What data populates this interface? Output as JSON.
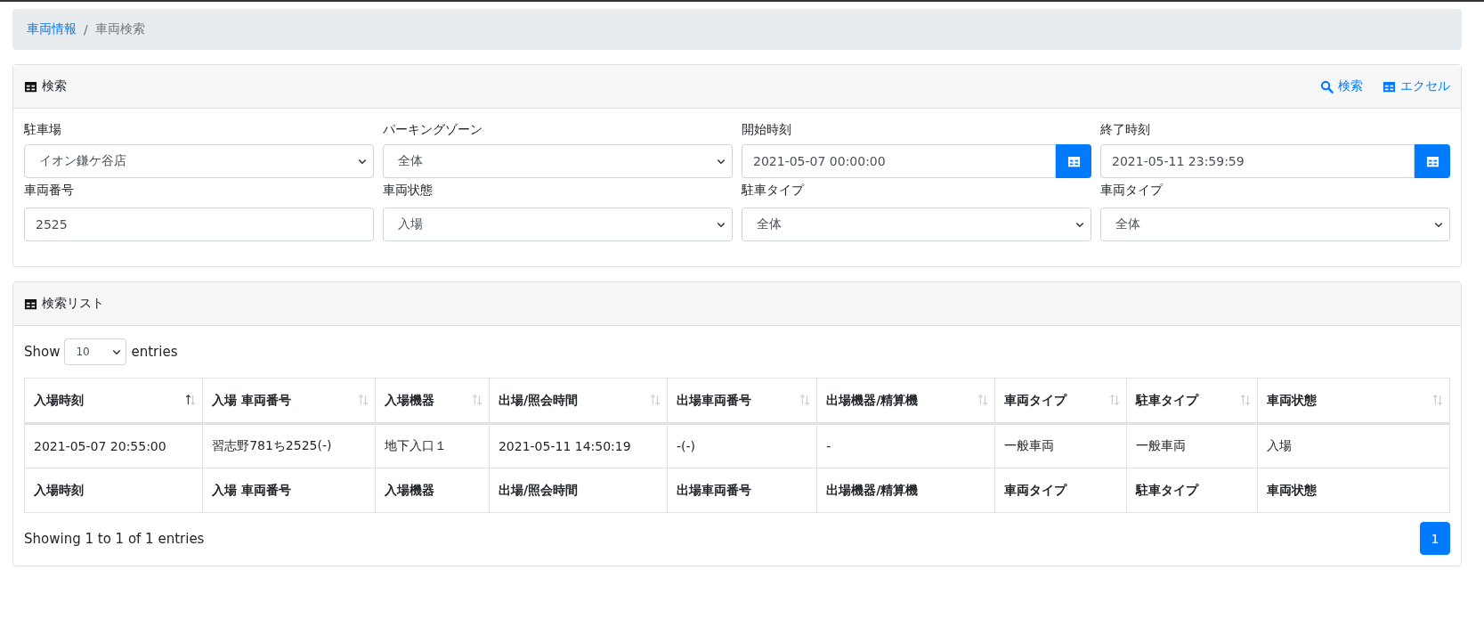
{
  "breadcrumb_separator": "/",
  "breadcrumb": [
    {
      "label": "車両情報",
      "kind": "link"
    },
    {
      "label": "車両検索",
      "kind": "current"
    }
  ],
  "search_panel": {
    "title": "検索",
    "actions": [
      {
        "label": "検索",
        "kind": "search"
      },
      {
        "label": "エクセル",
        "kind": "excel"
      }
    ],
    "fields": [
      {
        "label": "駐車場",
        "kind": "select",
        "value": "イオン鎌ケ谷店"
      },
      {
        "label": "パーキングゾーン",
        "kind": "select",
        "value": "全体"
      },
      {
        "label": "開始時刻",
        "kind": "datetime",
        "value": "2021-05-07 00:00:00"
      },
      {
        "label": "終了時刻",
        "kind": "datetime",
        "value": "2021-05-11 23:59:59"
      },
      {
        "label": "車両番号",
        "kind": "text",
        "value": "2525"
      },
      {
        "label": "車両状態",
        "kind": "select",
        "value": "入場"
      },
      {
        "label": "駐車タイプ",
        "kind": "select",
        "value": "全体"
      },
      {
        "label": "車両タイプ",
        "kind": "select",
        "value": "全体"
      }
    ]
  },
  "list_panel": {
    "title": "検索リスト",
    "show_label": "Show",
    "page_size": "10",
    "entries_label": "entries",
    "table": {
      "columns": [
        {
          "label": "入場時刻",
          "sorted": true
        },
        {
          "label": "入場 車両番号",
          "sorted": false
        },
        {
          "label": "入場機器",
          "sorted": false
        },
        {
          "label": "出場/照会時間",
          "sorted": false
        },
        {
          "label": "出場車両番号",
          "sorted": false
        },
        {
          "label": "出場機器/精算機",
          "sorted": false
        },
        {
          "label": "車両タイプ",
          "sorted": false
        },
        {
          "label": "駐車タイプ",
          "sorted": false
        },
        {
          "label": "車両状態",
          "sorted": false
        }
      ],
      "rows": [
        [
          "2021-05-07 20:55:00",
          "習志野781ち2525(-)",
          "地下入口１",
          "2021-05-11 14:50:19",
          "-(-)",
          "-",
          "一般車両",
          "一般車両",
          "入場"
        ]
      ],
      "footer": [
        "入場時刻",
        "入場 車両番号",
        "入場機器",
        "出場/照会時間",
        "出場車両番号",
        "出場機器/精算機",
        "車両タイプ",
        "駐車タイプ",
        "車両状態"
      ]
    },
    "info": "Showing 1 to 1 of 1 entries",
    "pages": [
      {
        "label": "1",
        "selected": true
      }
    ]
  }
}
